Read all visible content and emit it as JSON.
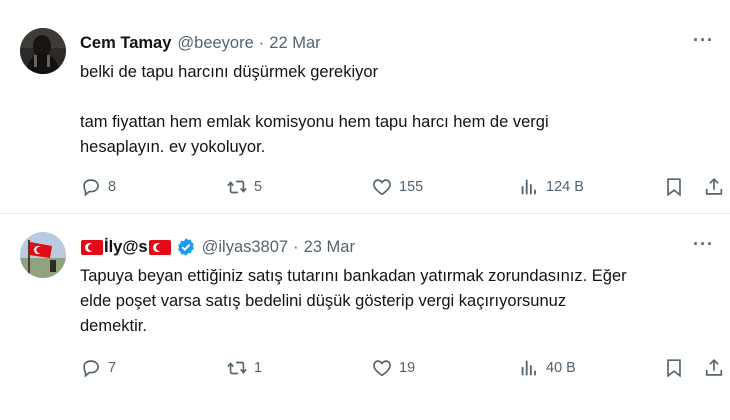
{
  "tweets": [
    {
      "name": "Cem Tamay",
      "handle": "@beeyore",
      "dot": "·",
      "date": "22 Mar",
      "more": "···",
      "text_line1": "belki de tapu harcını düşürmek gerekiyor",
      "text_line2": "tam fiyattan hem emlak komisyonu hem tapu harcı hem de vergi",
      "text_line3": "hesaplayın. ev yokoluyor.",
      "replies": "8",
      "retweets": "5",
      "likes": "155",
      "views": "124 B"
    },
    {
      "name_mid": "İly@s",
      "handle": "@ilyas3807",
      "dot": "·",
      "date": "23 Mar",
      "more": "···",
      "text_line1": "Tapuya beyan ettiğiniz satış tutarını bankadan yatırmak zorundasınız. Eğer",
      "text_line2": "elde poşet varsa satış bedelini düşük gösterip vergi kaçırıyorsunuz",
      "text_line3": "demektir.",
      "replies": "7",
      "retweets": "1",
      "likes": "19",
      "views": "40 B"
    }
  ],
  "colors": {
    "muted": "#536471",
    "text": "#0f1419",
    "verified": "#1d9bf0",
    "flag": "#e30a17",
    "divider": "#e6ebee"
  },
  "icons": [
    "reply-icon",
    "retweet-icon",
    "like-icon",
    "views-icon",
    "bookmark-icon",
    "share-icon",
    "verified-icon",
    "turkish-flag-icon"
  ]
}
